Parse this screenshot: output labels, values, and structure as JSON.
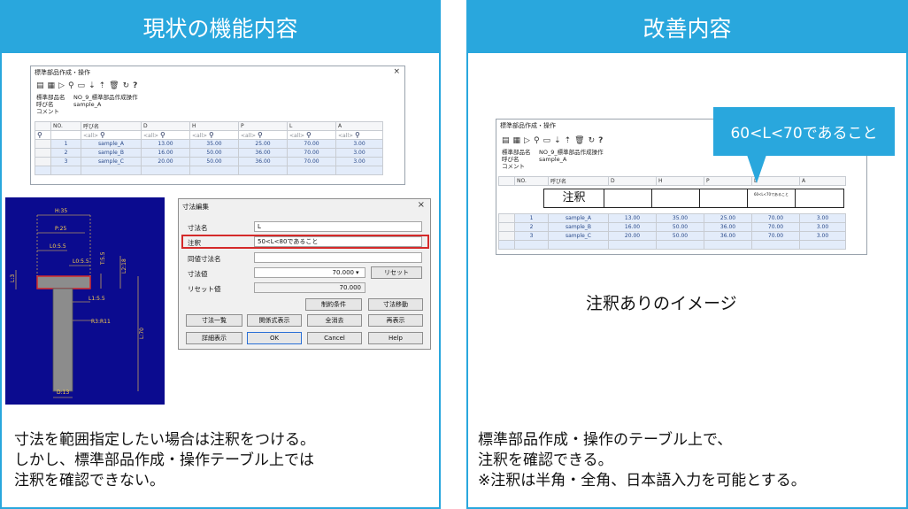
{
  "left": {
    "header": "現状の機能内容",
    "window": {
      "title": "標準部品作成・操作",
      "close": "×",
      "meta": [
        {
          "key": "標準部品名",
          "value": "NO_9_標準部品作成操作"
        },
        {
          "key": "呼び名",
          "value": "sample_A"
        },
        {
          "key": "コメント",
          "value": ""
        }
      ],
      "columns": [
        "NO.",
        "呼び名",
        "D",
        "H",
        "P",
        "L",
        "A"
      ],
      "filter": [
        "<all>",
        "<all>",
        "<all>",
        "<all>",
        "<all>",
        "<all>"
      ],
      "rows": [
        [
          "1",
          "sample_A",
          "13.00",
          "35.00",
          "25.00",
          "70.00",
          "3.00"
        ],
        [
          "2",
          "sample_B",
          "16.00",
          "50.00",
          "36.00",
          "70.00",
          "3.00"
        ],
        [
          "3",
          "sample_C",
          "20.00",
          "50.00",
          "36.00",
          "70.00",
          "3.00"
        ]
      ]
    },
    "drawing": {
      "dims": [
        "H:35",
        "P:25",
        "L0:5.5",
        "L0:5.5",
        "T:5.5",
        "L2:18",
        "L:3",
        "L1:5.5",
        "R3:R11",
        "L:70",
        "D:13"
      ]
    },
    "dialog": {
      "title": "寸法編集",
      "close": "×",
      "labels": {
        "name": "寸法名",
        "note": "注釈",
        "same": "同値寸法名",
        "value": "寸法値",
        "reset_value": "リセット値"
      },
      "values": {
        "name": "L",
        "note": "50<L<80であること",
        "value": "70.000",
        "reset_value": "70.000"
      },
      "buttons": {
        "reset": "リセット",
        "constraint": "制約条件",
        "move": "寸法移動",
        "list": "寸法一覧",
        "relation": "関係式表示",
        "clear": "全消去",
        "redraw": "再表示",
        "detail": "詳細表示",
        "ok": "OK",
        "cancel": "Cancel",
        "help": "Help"
      }
    },
    "description": "寸法を範囲指定したい場合は注釈をつける。\nしかし、標準部品作成・操作テーブル上では\n注釈を確認できない。"
  },
  "right": {
    "header": "改善内容",
    "window": {
      "title": "標準部品作成・操作",
      "meta": [
        {
          "key": "標準部品名",
          "value": "NO_9_標準部品作成操作"
        },
        {
          "key": "呼び名",
          "value": "sample_A"
        },
        {
          "key": "コメント",
          "value": ""
        }
      ],
      "columns": [
        "NO.",
        "呼び名",
        "D",
        "H",
        "P",
        "L",
        "A"
      ],
      "rows": [
        [
          "1",
          "sample_A",
          "13.00",
          "35.00",
          "25.00",
          "70.00",
          "3.00"
        ],
        [
          "2",
          "sample_B",
          "16.00",
          "50.00",
          "36.00",
          "70.00",
          "3.00"
        ],
        [
          "3",
          "sample_C",
          "20.00",
          "50.00",
          "36.00",
          "70.00",
          "3.00"
        ]
      ]
    },
    "note_row": {
      "label": "注釈",
      "l_note": "60<L<70であること"
    },
    "callout": "60<L<70であること",
    "caption": "注釈ありのイメージ",
    "description": "標準部品作成・操作のテーブル上で、\n注釈を確認できる。\n※注釈は半角・全角、日本語入力を可能とする。"
  },
  "colors": {
    "accent": "#29a7dd",
    "highlight": "#d42a2a",
    "drawing_bg": "#0b0b8f"
  }
}
